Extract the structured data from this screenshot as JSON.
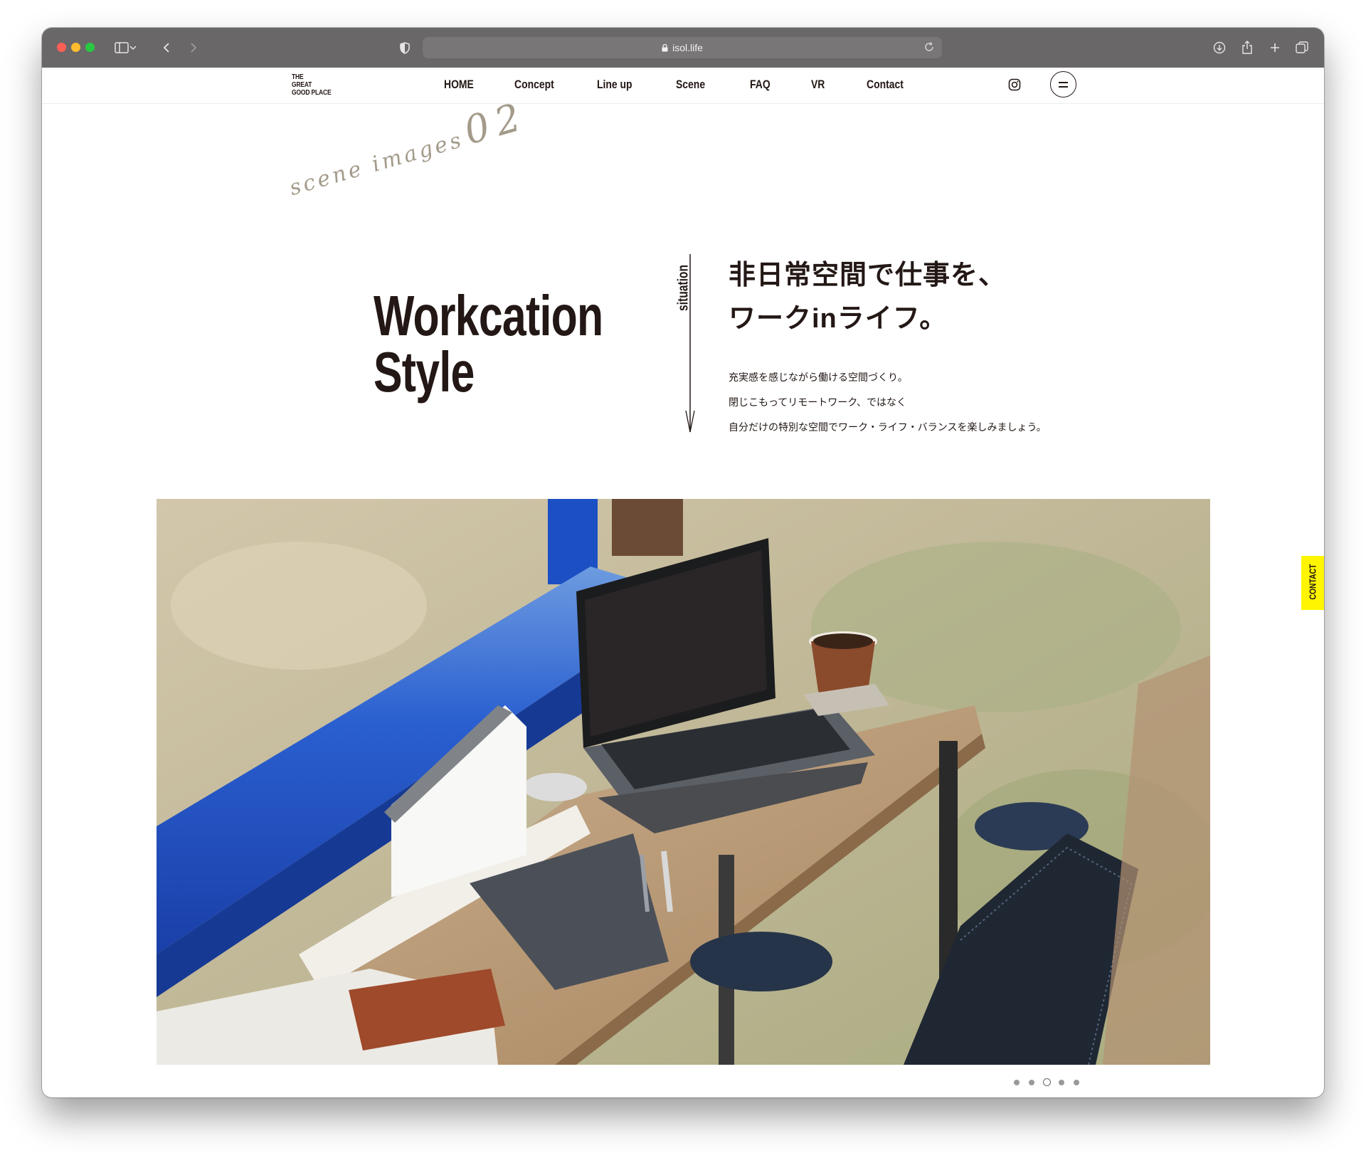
{
  "browser": {
    "url": "isol.life"
  },
  "header": {
    "logo_lines": [
      "THE",
      "GREAT",
      "GOOD PLACE"
    ],
    "nav": [
      "HOME",
      "Concept",
      "Line up",
      "Scene",
      "FAQ",
      "VR",
      "Contact"
    ]
  },
  "section": {
    "script_word": "scene images",
    "script_number": "02",
    "title_lines": [
      "Workcation",
      "Style"
    ],
    "situation_label": "situation",
    "headline_lines": [
      "非日常空間で仕事を、",
      "ワークinライフ。"
    ],
    "description_lines": [
      "充実感を感じながら働ける空間づくり。",
      "閉じこもってリモートワーク、ではなく",
      "自分だけの特別な空間でワーク・ライフ・バランスを楽しみましょう。"
    ]
  },
  "side_tab": {
    "label": "CONTACT"
  },
  "slider": {
    "count": 5,
    "active_index": 2
  },
  "colors": {
    "text": "#231815",
    "toolbar": "#6a6769",
    "script": "#a39a8a",
    "contact_tab": "#fff500"
  }
}
